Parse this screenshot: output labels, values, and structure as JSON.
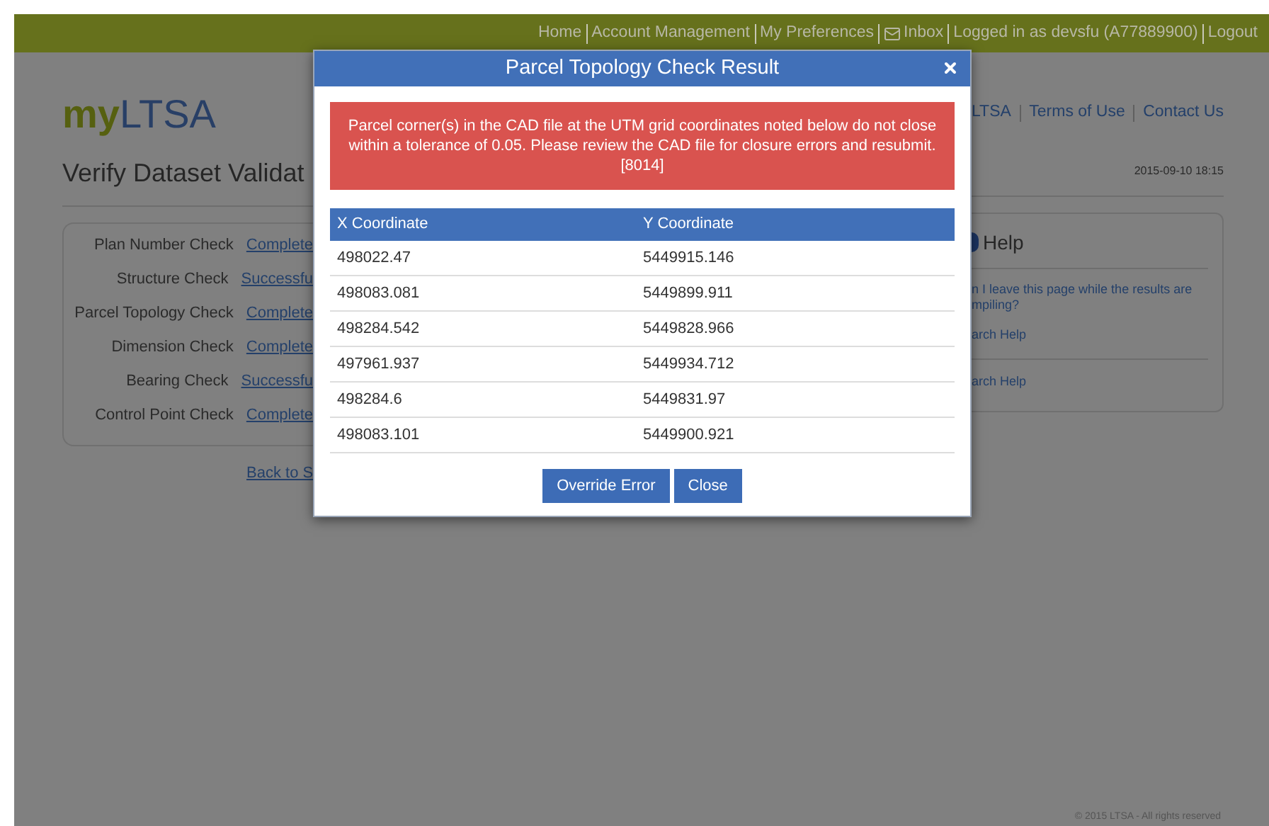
{
  "top_nav": [
    {
      "kind": "link",
      "label": "Home"
    },
    {
      "kind": "link",
      "label": "Account Management"
    },
    {
      "kind": "link",
      "label": "My Preferences"
    },
    {
      "kind": "inbox",
      "label": "Inbox"
    },
    {
      "kind": "text",
      "label": "Logged in as devsfu (A77889900)"
    },
    {
      "kind": "link",
      "label": "Logout"
    }
  ],
  "logo": {
    "prefix": "my",
    "name": "LTSA"
  },
  "header_links": [
    "LTSA",
    "Terms of Use",
    "Contact Us"
  ],
  "page_title": "Verify Dataset Validat",
  "timestamp": "2015-09-10 18:15",
  "checks": [
    {
      "label": "Plan Number Check",
      "result": "Complete"
    },
    {
      "label": "Structure Check",
      "result": "Successfu"
    },
    {
      "label": "Parcel Topology Check",
      "result": "Complete"
    },
    {
      "label": "Dimension Check",
      "result": "Complete"
    },
    {
      "label": "Bearing Check",
      "result": "Successfu"
    },
    {
      "label": "Control Point Check",
      "result": "Complete"
    }
  ],
  "back_link": "Back to S",
  "help": {
    "title": "Help",
    "question_lines": [
      "n I leave this page while the results are",
      "mpiling?"
    ],
    "links": [
      "arch Help",
      "arch Help"
    ]
  },
  "footer": "© 2015 LTSA - All rights reserved",
  "dialog": {
    "title": "Parcel Topology Check Result",
    "message": "Parcel corner(s) in the CAD file at the UTM grid coordinates noted below do not close within a tolerance of 0.05. Please review the CAD file for closure errors and resubmit. [8014]",
    "columns": [
      "X Coordinate",
      "Y Coordinate"
    ],
    "rows": [
      [
        "498022.47",
        "5449915.146"
      ],
      [
        "498083.081",
        "5449899.911"
      ],
      [
        "498284.542",
        "5449828.966"
      ],
      [
        "497961.937",
        "5449934.712"
      ],
      [
        "498284.6",
        "5449831.97"
      ],
      [
        "498083.101",
        "5449900.921"
      ]
    ],
    "buttons": [
      "Override Error",
      "Close"
    ]
  }
}
